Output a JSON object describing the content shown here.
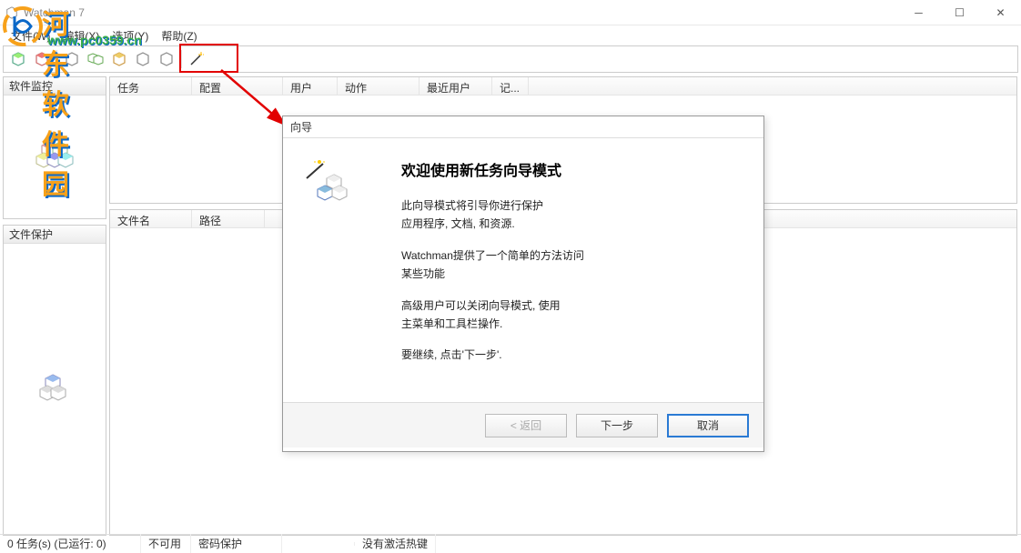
{
  "window": {
    "title": "Watchman 7",
    "controls": {
      "min": "─",
      "max": "☐",
      "close": "✕"
    }
  },
  "menu": {
    "file": "文件(W)",
    "edit": "编辑(X)",
    "options": "选项(Y)",
    "help": "帮助(Z)"
  },
  "sidebar": {
    "monitor_label": "软件监控",
    "protect_label": "文件保护"
  },
  "list_top": {
    "cols": {
      "task": "任务",
      "config": "配置",
      "user": "用户",
      "action": "动作",
      "recent_user": "最近用户",
      "record": "记..."
    }
  },
  "list_bottom": {
    "cols": {
      "filename": "文件名",
      "path": "路径"
    }
  },
  "status": {
    "tasks": "0 任务(s) (已运行: 0)",
    "available": "不可用",
    "pwd": "密码保护",
    "hotkey": "没有激活热键"
  },
  "wizard": {
    "title": "向导",
    "heading": "欢迎使用新任务向导模式",
    "p1a": "此向导模式将引导你进行保护",
    "p1b": "应用程序, 文档, 和资源.",
    "p2a": "Watchman提供了一个简单的方法访问",
    "p2b": "某些功能",
    "p3a": "高级用户可以关闭向导模式, 使用",
    "p3b": "主菜单和工具栏操作.",
    "p4": "要继续, 点击'下一步'.",
    "buttons": {
      "back": "< 返回",
      "next": "下一步",
      "cancel": "取消"
    }
  },
  "watermark": {
    "text": "河东软件园",
    "url": "www.pc0359.cn"
  }
}
